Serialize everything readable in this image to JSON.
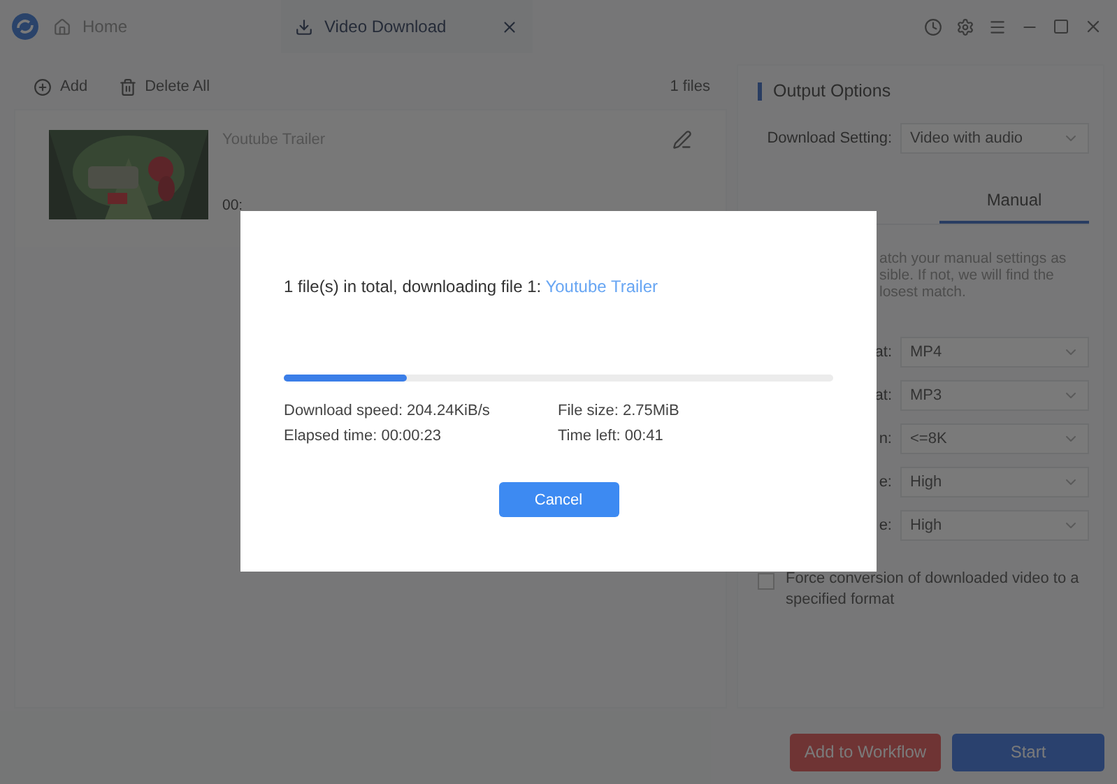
{
  "window": {
    "tabs": [
      {
        "label": "Home",
        "kind": "home",
        "selected": false
      },
      {
        "label": "Video Download",
        "kind": "download",
        "selected": true
      }
    ]
  },
  "toolbar": {
    "add": "Add",
    "delete_all": "Delete All",
    "count": "1 files"
  },
  "files": [
    {
      "title": "Youtube Trailer",
      "duration": "00:"
    }
  ],
  "output_options": {
    "title": "Output Options",
    "download_setting": {
      "label": "Download Setting:",
      "value": "Video with audio"
    },
    "tabs": [
      {
        "label": "Manual",
        "selected": true
      }
    ],
    "hint": [
      "atch your manual settings as",
      "sible. If not, we will find the",
      "losest match."
    ],
    "settings": [
      {
        "label": "at:",
        "value": "MP4"
      },
      {
        "label": "at:",
        "value": "MP3"
      },
      {
        "label": "n:",
        "value": "<=8K"
      },
      {
        "label": "e:",
        "value": "High"
      },
      {
        "label": "e:",
        "value": "High"
      }
    ],
    "force_conversion": {
      "label": "Force conversion of downloaded video to a specified format",
      "checked": false
    }
  },
  "footer": {
    "buttons": [
      {
        "label": "Add to Workflow",
        "kind": "workflow"
      },
      {
        "label": "Start",
        "kind": "start"
      }
    ]
  },
  "dialog": {
    "message": "1 file(s) in total, downloading file 1: ",
    "file": "Youtube Trailer",
    "level": 0.224,
    "stats": [
      "Download speed: 204.24KiB/s",
      "File size: 2.75MiB",
      "Elapsed time: 00:00:23",
      "Time left: 00:41"
    ],
    "cancel": "Cancel"
  }
}
